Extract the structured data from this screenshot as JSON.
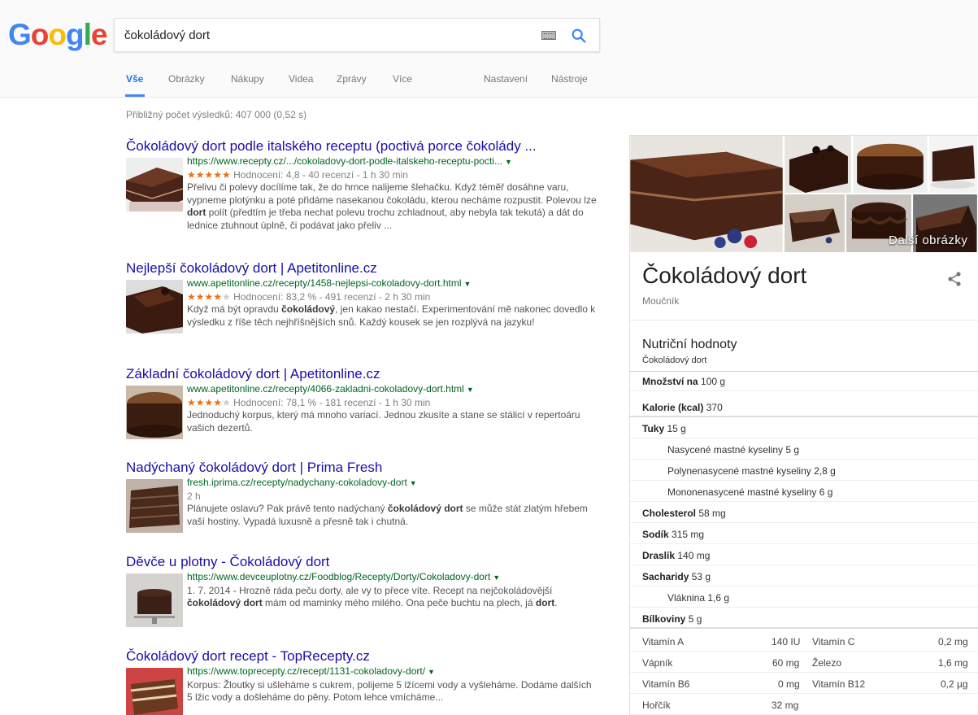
{
  "logo": "Google",
  "search": {
    "query": "čokoládový dort"
  },
  "tabs": {
    "all": "Vše",
    "images": "Obrázky",
    "shopping": "Nákupy",
    "videos": "Videa",
    "news": "Zprávy",
    "more": "Více",
    "settings": "Nastavení",
    "tools": "Nástroje"
  },
  "stats": "Přibližný počet výsledků: 407 000 (0,52 s)",
  "colors": {
    "link": "#1a0dab",
    "url": "#006621",
    "star": "#e7711b",
    "accent": "#4285f4"
  },
  "results": [
    {
      "title": "Čokoládový dort podle italského receptu (poctivá porce čokolády ...",
      "url": "https://www.recepty.cz/.../cokoladovy-dort-podle-italskeho-receptu-pocti...",
      "stars": "★★★★★",
      "stars_off": "",
      "meta": "Hodnocení: 4,8 - 40 recenzí - 1 h 30 min",
      "rating": 4.8,
      "snippet": "Přelivu či polevy docílíme tak, že do hrnce nalijeme šlehačku. Když téměř dosáhne varu, vypneme plotýnku a poté přidáme nasekanou čokoládu, kterou necháme rozpustit. Polevou lze dort polít (předtím je třeba nechat polevu trochu zchladnout, aby nebyla tak tekutá) a dát do lednice ztuhnout úplně, či podávat jako přeliv ..."
    },
    {
      "title": "Nejlepší čokoládový dort | Apetitonline.cz",
      "url": "www.apetitonline.cz/recepty/1458-nejlepsi-cokoladovy-dort.html",
      "stars": "★★★★",
      "stars_off": "★",
      "meta": "Hodnocení: 83,2 % - 491 recenzí - 2 h 30 min",
      "rating": 0.832,
      "snippet": "Když má být opravdu čokoládový, jen kakao nestačí. Experimentování mě nakonec dovedlo k výsledku z říše těch nejhříšnějších snů. Každý kousek se jen rozplývá na jazyku!"
    },
    {
      "title": "Základní čokoládový dort | Apetitonline.cz",
      "url": "www.apetitonline.cz/recepty/4066-zakladni-cokoladovy-dort.html",
      "stars": "★★★★",
      "stars_off": "★",
      "meta": "Hodnocení: 78,1 % - 181 recenzí - 1 h 30 min",
      "rating": 0.781,
      "snippet": "Jednoduchý korpus, který má mnoho variací. Jednou zkusíte a stane se stálicí v repertoáru vašich dezertů."
    },
    {
      "title": "Nadýchaný čokoládový dort | Prima Fresh",
      "url": "fresh.iprima.cz/recepty/nadychany-cokoladovy-dort",
      "meta": "2 h",
      "snippet": "Plánujete oslavu? Pak právě tento nadýchaný čokoládový dort se může stát zlatým hřebem vaší hostiny. Vypadá luxusně a přesně tak i chutná."
    },
    {
      "title": "Děvče u plotny - Čokoládový dort",
      "url": "https://www.devceuplotny.cz/Foodblog/Recepty/Dorty/Cokoladovy-dort",
      "meta": "1. 7. 2014",
      "snippet": "Hrozně ráda peču dorty, ale vy to přece víte. Recept na nejčokoládovější čokoládový dort mám od maminky mého milého. Ona peče buchtu na plech, já dort."
    },
    {
      "title": "Čokoládový dort recept - TopRecepty.cz",
      "url": "https://www.toprecepty.cz/recept/1131-cokoladovy-dort/",
      "snippet": "Korpus: Žloutky si ušleháme s cukrem, polijeme 5 lžícemi vody a vyšleháme. Dodáme dalších 5 lžic vody a došleháme do pěny. Potom lehce vmícháme..."
    }
  ],
  "knowledge_panel": {
    "more_images": "Další obrázky",
    "title": "Čokoládový dort",
    "subtitle": "Moučník",
    "nutrition_heading": "Nutriční hodnoty",
    "nutrition_sub": "Čokoládový dort",
    "amount_label": "Množství na",
    "amount_value": "100 g",
    "calories_label": "Kalorie (kcal)",
    "calories_value": "370",
    "fat_label": "Tuky",
    "fat_value": "15 g",
    "sat_fat": "Nasycené mastné kyseliny 5 g",
    "poly_fat": "Polynenasycené mastné kyseliny 2,8 g",
    "mono_fat": "Mononenasycené mastné kyseliny 6 g",
    "chol_label": "Cholesterol",
    "chol_value": "58 mg",
    "sodium_label": "Sodík",
    "sodium_value": "315 mg",
    "potassium_label": "Draslík",
    "potassium_value": "140 mg",
    "carbs_label": "Sacharidy",
    "carbs_value": "53 g",
    "fiber": "Vláknina 1,6 g",
    "protein_label": "Bílkoviny",
    "protein_value": "5 g",
    "vitamins": [
      {
        "n1": "Vitamín A",
        "v1": "140 IU",
        "n2": "Vitamín C",
        "v2": "0,2 mg"
      },
      {
        "n1": "Vápník",
        "v1": "60 mg",
        "n2": "Železo",
        "v2": "1,6 mg"
      },
      {
        "n1": "Vitamín B6",
        "v1": "0 mg",
        "n2": "Vitamín B12",
        "v2": "0,2 µg"
      },
      {
        "n1": "Hořčík",
        "v1": "32 mg",
        "n2": "",
        "v2": ""
      }
    ]
  }
}
